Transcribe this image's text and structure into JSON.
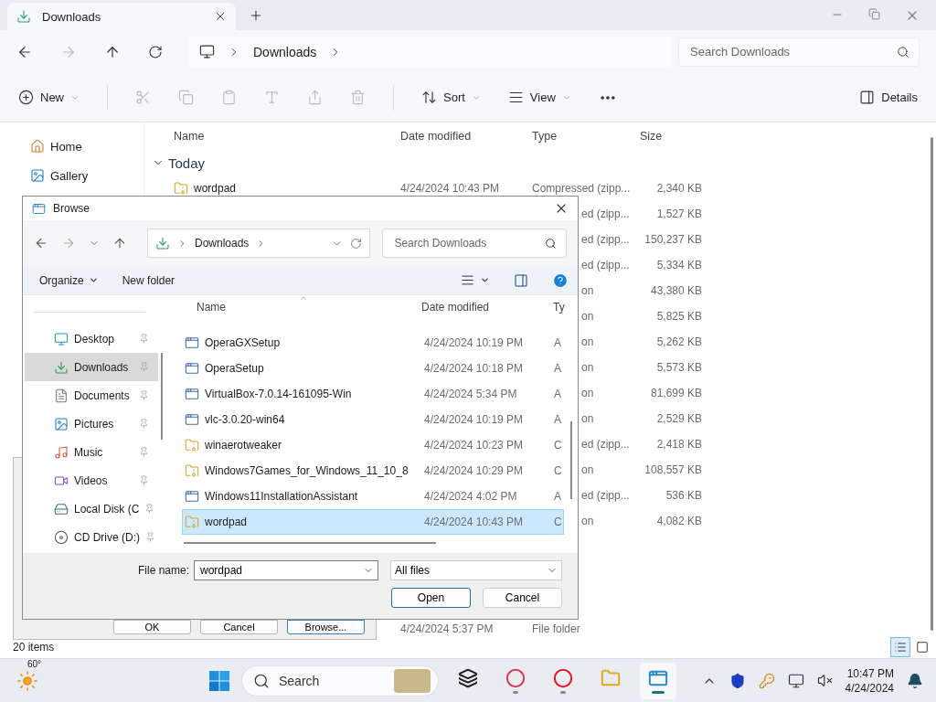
{
  "explorer": {
    "tab": {
      "title": "Downloads"
    },
    "crumbs": [
      "Downloads"
    ],
    "search": {
      "placeholder": "Search Downloads"
    },
    "toolbar": {
      "new": "New",
      "sort": "Sort",
      "view": "View",
      "details": "Details"
    },
    "nav": [
      {
        "label": "Home"
      },
      {
        "label": "Gallery"
      }
    ],
    "columns": [
      "Name",
      "Date modified",
      "Type",
      "Size"
    ],
    "group": {
      "label": "Today",
      "expanded": true
    },
    "rows": [
      {
        "name": "wordpad",
        "date": "4/24/2024 10:43 PM",
        "type": "Compressed (zipp...",
        "size": "2,340 KB"
      },
      {
        "type": "ed (zipp...",
        "size": "1,527 KB"
      },
      {
        "type": "ed (zipp...",
        "size": "150,237 KB"
      },
      {
        "type": "ed (zipp...",
        "size": "5,334 KB"
      },
      {
        "type": "on",
        "size": "43,380 KB"
      },
      {
        "type": "on",
        "size": "5,825 KB"
      },
      {
        "type": "on",
        "size": "5,262 KB"
      },
      {
        "type": "on",
        "size": "5,573 KB"
      },
      {
        "type": "on",
        "size": "81,699 KB"
      },
      {
        "type": "on",
        "size": "2,529 KB"
      },
      {
        "type": "ed (zipp...",
        "size": "2,418 KB"
      },
      {
        "type": "on",
        "size": "108,557 KB"
      },
      {
        "type": "ed (zipp...",
        "size": "536 KB"
      },
      {
        "type": "on",
        "size": "4,082 KB"
      }
    ],
    "last_row": {
      "date": "4/24/2024 5:37 PM",
      "type": "File folder"
    },
    "status": "20 items",
    "view_buttons": [
      {
        "selected": true
      },
      {
        "selected": false
      }
    ]
  },
  "back_dialog": {
    "buttons": [
      {
        "label": "OK",
        "default": false
      },
      {
        "label": "Cancel",
        "default": false
      },
      {
        "label": "Browse...",
        "default": true
      }
    ]
  },
  "dialog": {
    "title": "Browse",
    "crumbs": [
      "Downloads"
    ],
    "search": {
      "placeholder": "Search Downloads"
    },
    "organize": "Organize",
    "new_folder": "New folder",
    "nav": [
      {
        "label": "Desktop",
        "selected": false
      },
      {
        "label": "Downloads",
        "selected": true
      },
      {
        "label": "Documents",
        "selected": false
      },
      {
        "label": "Pictures",
        "selected": false
      },
      {
        "label": "Music",
        "selected": false
      },
      {
        "label": "Videos",
        "selected": false
      },
      {
        "label": "Local Disk (C",
        "selected": false
      },
      {
        "label": "CD Drive (D:)",
        "selected": false
      }
    ],
    "columns": [
      "Name",
      "Date modified",
      "Ty"
    ],
    "files": [
      {
        "name": "OperaGXSetup",
        "date": "4/24/2024 10:19 PM",
        "type": "A",
        "kind": "app",
        "selected": false
      },
      {
        "name": "OperaSetup",
        "date": "4/24/2024 10:18 PM",
        "type": "A",
        "kind": "app",
        "selected": false
      },
      {
        "name": "VirtualBox-7.0.14-161095-Win",
        "date": "4/24/2024 5:34 PM",
        "type": "A",
        "kind": "app",
        "selected": false
      },
      {
        "name": "vlc-3.0.20-win64",
        "date": "4/24/2024 10:19 PM",
        "type": "A",
        "kind": "app",
        "selected": false
      },
      {
        "name": "winaerotweaker",
        "date": "4/24/2024 10:23 PM",
        "type": "C",
        "kind": "archive",
        "selected": false
      },
      {
        "name": "Windows7Games_for_Windows_11_10_8",
        "date": "4/24/2024 10:29 PM",
        "type": "C",
        "kind": "archive",
        "selected": false
      },
      {
        "name": "Windows11InstallationAssistant",
        "date": "4/24/2024 4:02 PM",
        "type": "A",
        "kind": "app",
        "selected": false
      },
      {
        "name": "wordpad",
        "date": "4/24/2024 10:43 PM",
        "type": "C",
        "kind": "archive",
        "selected": true
      }
    ],
    "file_name_label": "File name:",
    "file_name": "wordpad",
    "filter": "All files",
    "buttons": [
      {
        "label": "Open",
        "default": true
      },
      {
        "label": "Cancel",
        "default": false
      }
    ]
  },
  "taskbar": {
    "weather": "60°",
    "search": "Search",
    "apps": [
      {
        "running": false,
        "active": false
      },
      {
        "running": true,
        "active": false
      },
      {
        "running": true,
        "active": false
      },
      {
        "running": false,
        "active": false
      },
      {
        "running": true,
        "active": true
      }
    ],
    "time": "10:47 PM",
    "date": "4/24/2024"
  }
}
